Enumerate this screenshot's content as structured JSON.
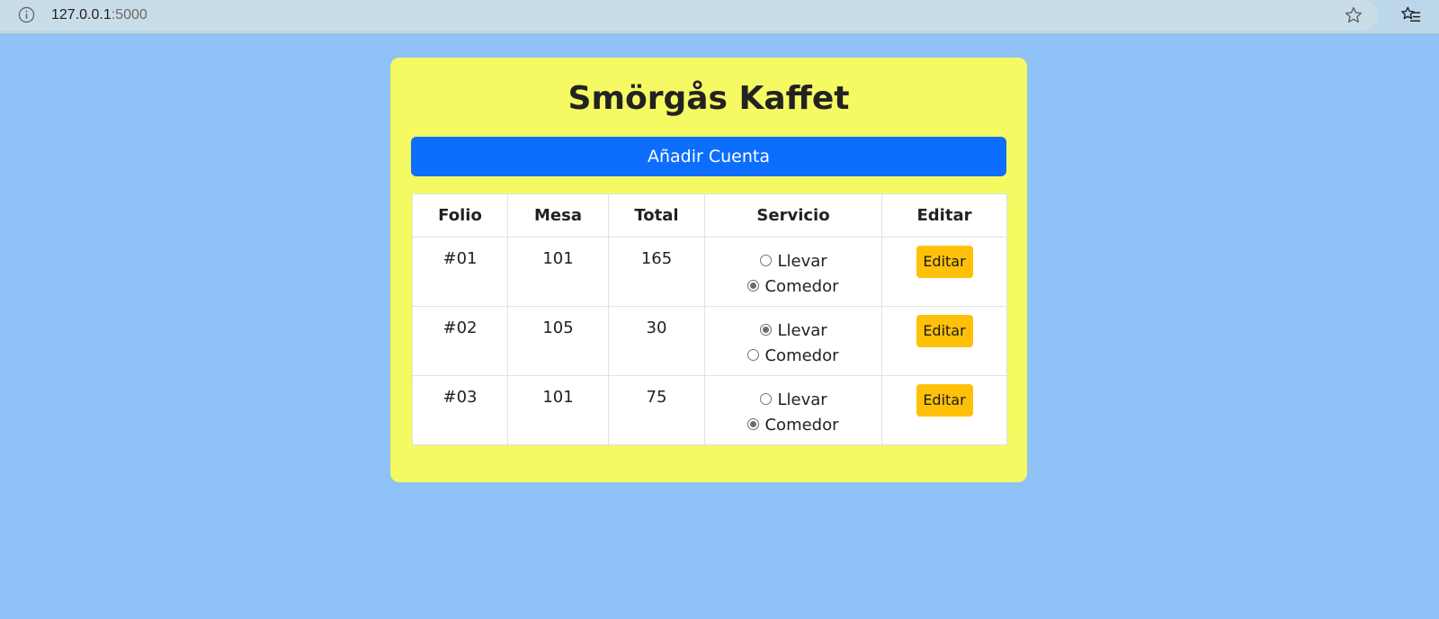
{
  "browser": {
    "url_host": "127.0.0.1",
    "url_port": ":5000",
    "info_icon": "info-icon",
    "star_icon": "star-icon",
    "favorites_icon": "favorites-icon"
  },
  "app": {
    "title": "Smörgås Kaffet",
    "add_button_label": "Añadir Cuenta"
  },
  "table": {
    "headers": [
      "Folio",
      "Mesa",
      "Total",
      "Servicio",
      "Editar"
    ],
    "rows": [
      {
        "folio": "#01",
        "mesa": "101",
        "total": "165",
        "service_options": [
          "Llevar",
          "Comedor"
        ],
        "selected": "Comedor",
        "edit_label": "Editar"
      },
      {
        "folio": "#02",
        "mesa": "105",
        "total": "30",
        "service_options": [
          "Llevar",
          "Comedor"
        ],
        "selected": "Llevar",
        "edit_label": "Editar"
      },
      {
        "folio": "#03",
        "mesa": "101",
        "total": "75",
        "service_options": [
          "Llevar",
          "Comedor"
        ],
        "selected": "Comedor",
        "edit_label": "Editar"
      }
    ]
  },
  "colors": {
    "page_background": "#8fc2f7",
    "card_background": "#f5f962",
    "primary_button": "#0d6efd",
    "edit_button": "#ffc107"
  }
}
